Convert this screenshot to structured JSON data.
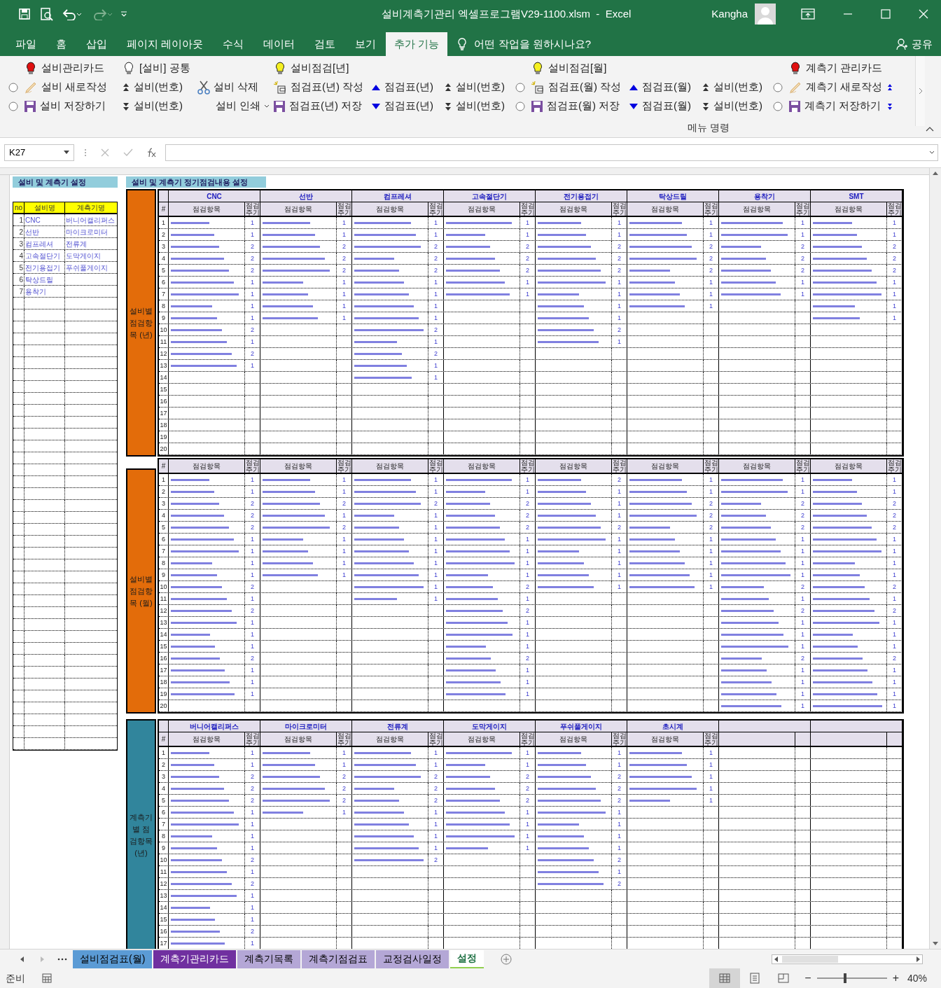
{
  "window": {
    "title": "설비계측기관리 엑셀프로그램V29-1100.xlsm  -  Excel",
    "user": "Kangha"
  },
  "tabs": [
    {
      "label": "파일",
      "selected": false
    },
    {
      "label": "홈",
      "selected": false
    },
    {
      "label": "삽입",
      "selected": false
    },
    {
      "label": "페이지 레이아웃",
      "selected": false
    },
    {
      "label": "수식",
      "selected": false
    },
    {
      "label": "데이터",
      "selected": false
    },
    {
      "label": "검토",
      "selected": false
    },
    {
      "label": "보기",
      "selected": false
    },
    {
      "label": "추가 기능",
      "selected": true
    }
  ],
  "tell_me": "어떤 작업을 원하시나요?",
  "share": "공유",
  "ribbon": {
    "group_label": "메뉴 명령",
    "columns": [
      {
        "middle": {
          "kind": "radio",
          "checked": false
        },
        "bottom": {
          "kind": "radio",
          "checked": false
        }
      },
      {
        "top": {
          "kind": "bulb",
          "color": "#e01010",
          "label": "설비관리카드"
        },
        "middle": {
          "kind": "pencil",
          "label": "설비 새로작성"
        },
        "bottom": {
          "kind": "save",
          "label": "설비 저장하기"
        }
      },
      {
        "top": {
          "kind": "bulb",
          "color": "#ffffff",
          "label": "[설비] 공통"
        },
        "middle": {
          "kind": "step_up",
          "label": "설비(번호)"
        },
        "bottom": {
          "kind": "step_down",
          "label": "설비(번호)"
        }
      },
      {
        "middle": {
          "kind": "scissors",
          "label": "설비 삭제"
        },
        "bottom": {
          "kind": "dropdown",
          "label": "설비 인쇄"
        }
      },
      {
        "top": {
          "kind": "bulb",
          "color": "#f5f020",
          "label": "설비점검[년]"
        },
        "middle": {
          "kind": "new_sheet",
          "label": "점검표(년) 작성"
        },
        "bottom": {
          "kind": "save",
          "label": "점검표(년) 저장"
        }
      },
      {
        "middle": {
          "kind": "triangle_up",
          "label": "점검표(년)"
        },
        "bottom": {
          "kind": "triangle_down",
          "label": "점검표(년)"
        }
      },
      {
        "middle": {
          "kind": "step_up",
          "label": "설비(번호)"
        },
        "bottom": {
          "kind": "step_down",
          "label": "설비(번호)"
        }
      },
      {
        "middle": {
          "kind": "radio",
          "checked": false
        },
        "bottom": {
          "kind": "radio",
          "checked": false
        }
      },
      {
        "top": {
          "kind": "bulb",
          "color": "#f5f020",
          "label": "설비점검[월]"
        },
        "middle": {
          "kind": "new_sheet",
          "label": "점검표(월) 작성"
        },
        "bottom": {
          "kind": "save",
          "label": "점검표(월) 저장"
        }
      },
      {
        "middle": {
          "kind": "triangle_up",
          "label": "점검표(월)"
        },
        "bottom": {
          "kind": "triangle_down",
          "label": "점검표(월)"
        }
      },
      {
        "middle": {
          "kind": "step_up",
          "label": "설비(번호)"
        },
        "bottom": {
          "kind": "step_down",
          "label": "설비(번호)"
        }
      },
      {
        "middle": {
          "kind": "radio",
          "checked": false
        },
        "bottom": {
          "kind": "radio",
          "checked": false
        }
      },
      {
        "top": {
          "kind": "bulb",
          "color": "#e01010",
          "label": "계측기 관리카드"
        },
        "middle": {
          "kind": "pencil",
          "label": "계측기 새로작성"
        },
        "bottom": {
          "kind": "save",
          "label": "계측기 저장하기"
        }
      },
      {
        "middle": {
          "kind": "step_up_blue"
        },
        "bottom": {
          "kind": "step_down_blue"
        }
      }
    ]
  },
  "name_box": "K27",
  "settings_title": "설비 및 계측기 설정",
  "equipment_table": {
    "headings": [
      "no",
      "설비명",
      "계측기명"
    ],
    "rows": [
      [
        "1",
        "CNC",
        "버니어캘리퍼스"
      ],
      [
        "2",
        "선반",
        "마이크로미터"
      ],
      [
        "3",
        "컴프레셔",
        "전류계"
      ],
      [
        "4",
        "고속절단기",
        "도막게이지"
      ],
      [
        "5",
        "전기용접기",
        "푸쉬풀게이지"
      ],
      [
        "6",
        "탁상드릴",
        ""
      ],
      [
        "7",
        "용착기",
        ""
      ]
    ]
  },
  "inspection_title": "설비 및 계측기 정기점검내용 설정",
  "blocks": [
    {
      "label": "설비별 점검항목 (년)",
      "color": "#e36c0a",
      "hash": "#",
      "row_numbers": [
        "1",
        "2",
        "3",
        "4",
        "5",
        "6",
        "7",
        "8",
        "9",
        "10",
        "11",
        "12",
        "13",
        "14",
        "15",
        "16",
        "17",
        "18",
        "19",
        "20"
      ],
      "columns": [
        {
          "name": "CNC",
          "item_heading": "점검항목",
          "period_heading": "점검주기",
          "periods": [
            "1",
            "1",
            "2",
            "2",
            "2",
            "1",
            "1",
            "1",
            "1",
            "2",
            "1",
            "2",
            "1"
          ]
        },
        {
          "name": "선반",
          "item_heading": "점검항목",
          "period_heading": "점검주기",
          "periods": [
            "1",
            "1",
            "2",
            "2",
            "2",
            "1",
            "1",
            "1",
            "1"
          ]
        },
        {
          "name": "컴프레셔",
          "item_heading": "점검항목",
          "period_heading": "점검주기",
          "periods": [
            "1",
            "1",
            "2",
            "2",
            "2",
            "1",
            "1",
            "1",
            "1",
            "2",
            "1",
            "2",
            "1",
            "1"
          ]
        },
        {
          "name": "고속절단기",
          "item_heading": "점검항목",
          "period_heading": "점검주기",
          "periods": [
            "1",
            "1",
            "2",
            "2",
            "2",
            "1",
            "1"
          ]
        },
        {
          "name": "전기용접기",
          "item_heading": "점검항목",
          "period_heading": "점검주기",
          "periods": [
            "1",
            "1",
            "2",
            "2",
            "2",
            "1",
            "1",
            "1",
            "1",
            "2",
            "1"
          ]
        },
        {
          "name": "탁상드릴",
          "item_heading": "점검항목",
          "period_heading": "점검주기",
          "periods": [
            "1",
            "1",
            "2",
            "2",
            "2",
            "1",
            "1",
            "1"
          ]
        },
        {
          "name": "용착기",
          "item_heading": "점검항목",
          "period_heading": "점검주기",
          "periods": [
            "1",
            "1",
            "2",
            "2",
            "2",
            "1",
            "1"
          ]
        },
        {
          "name": "SMT",
          "item_heading": "점검항목",
          "period_heading": "점검주기",
          "periods": [
            "1",
            "1",
            "2",
            "2",
            "2",
            "1",
            "1",
            "1",
            "1"
          ]
        }
      ]
    },
    {
      "label": "설비별 점검항목 (월)",
      "color": "#e36c0a",
      "hash": "#",
      "row_numbers": [
        "1",
        "2",
        "3",
        "4",
        "5",
        "6",
        "7",
        "8",
        "9",
        "10",
        "11",
        "12",
        "13",
        "14",
        "15",
        "16",
        "17",
        "18",
        "19",
        "20"
      ],
      "columns": [
        {
          "item_heading": "점검항목",
          "period_heading": "점검주기",
          "periods": [
            "1",
            "1",
            "2",
            "2",
            "2",
            "1",
            "1",
            "1",
            "1",
            "2",
            "1",
            "2",
            "1",
            "1",
            "1",
            "2",
            "1",
            "1",
            "1"
          ]
        },
        {
          "item_heading": "점검항목",
          "period_heading": "점검주기",
          "periods": [
            "1",
            "1",
            "2",
            "1",
            "2",
            "1",
            "1",
            "1",
            "1"
          ]
        },
        {
          "item_heading": "점검항목",
          "period_heading": "점검주기",
          "periods": [
            "1",
            "1",
            "2",
            "1",
            "1",
            "1",
            "1",
            "1",
            "1",
            "1",
            "1"
          ]
        },
        {
          "item_heading": "점검항목",
          "period_heading": "점검주기",
          "periods": [
            "1",
            "1",
            "2",
            "2",
            "2",
            "1",
            "1",
            "1",
            "1",
            "2",
            "1",
            "2",
            "1",
            "1",
            "1",
            "2",
            "1",
            "1",
            "1"
          ]
        },
        {
          "item_heading": "점검항목",
          "period_heading": "점검주기",
          "periods": [
            "2",
            "1",
            "1",
            "1",
            "2",
            "1",
            "1",
            "1",
            "1",
            "1"
          ]
        },
        {
          "item_heading": "점검항목",
          "period_heading": "점검주기",
          "periods": [
            "1",
            "1",
            "2",
            "2",
            "2",
            "1",
            "1",
            "1",
            "1",
            "1"
          ]
        },
        {
          "item_heading": "점검항목",
          "period_heading": "점검주기",
          "periods": [
            "1",
            "1",
            "2",
            "2",
            "2",
            "1",
            "1",
            "1",
            "1",
            "2",
            "1",
            "2",
            "1",
            "1",
            "1",
            "2",
            "1",
            "1",
            "1",
            "1"
          ]
        },
        {
          "item_heading": "점검항목",
          "period_heading": "점검주기",
          "periods": [
            "1",
            "1",
            "2",
            "2",
            "2",
            "1",
            "1",
            "1",
            "1",
            "2",
            "1",
            "2",
            "1",
            "1",
            "1",
            "2",
            "1",
            "1",
            "1",
            "1"
          ]
        }
      ]
    },
    {
      "label": "계측기별 점검항목 (년)",
      "color": "#31859c",
      "hash": "#",
      "row_numbers": [
        "1",
        "2",
        "3",
        "4",
        "5",
        "6",
        "7",
        "8",
        "9",
        "10",
        "11",
        "12",
        "13",
        "14",
        "15",
        "16",
        "17"
      ],
      "columns": [
        {
          "name": "버니어캘리퍼스",
          "item_heading": "점검항목",
          "period_heading": "점검주기",
          "periods": [
            "1",
            "1",
            "2",
            "2",
            "2",
            "1",
            "1",
            "1",
            "1",
            "2",
            "1",
            "2",
            "1",
            "1",
            "1",
            "2",
            "1"
          ]
        },
        {
          "name": "마이크로미터",
          "item_heading": "점검항목",
          "period_heading": "점검주기",
          "periods": [
            "1",
            "1",
            "2",
            "2",
            "2",
            "1"
          ]
        },
        {
          "name": "전류계",
          "item_heading": "점검항목",
          "period_heading": "점검주기",
          "periods": [
            "1",
            "1",
            "2",
            "2",
            "2",
            "1",
            "1",
            "1",
            "1",
            "2"
          ]
        },
        {
          "name": "도막게이지",
          "item_heading": "점검항목",
          "period_heading": "점검주기",
          "periods": [
            "1",
            "1",
            "2",
            "2",
            "2",
            "1",
            "1",
            "1",
            "1"
          ]
        },
        {
          "name": "푸쉬풀게이지",
          "item_heading": "점검항목",
          "period_heading": "점검주기",
          "periods": [
            "1",
            "1",
            "2",
            "2",
            "2",
            "1",
            "1",
            "1",
            "1",
            "2",
            "1",
            "2"
          ]
        },
        {
          "name": "초시계",
          "item_heading": "점검항목",
          "period_heading": "점검주기",
          "periods": [
            "1",
            "1",
            "1",
            "1",
            "1"
          ]
        }
      ]
    }
  ],
  "sheet_tabs": [
    {
      "label": "설비점검표(월)",
      "color": "#5b9bd5",
      "selected": false
    },
    {
      "label": "계측기관리카드",
      "color": "#7030a0",
      "selected": false
    },
    {
      "label": "계측기목록",
      "color": "#b4a7d6",
      "selected": false
    },
    {
      "label": "계측기점검표",
      "color": "#b4a7d6",
      "selected": false
    },
    {
      "label": "교정검사일정",
      "color": "#b4a7d6",
      "selected": false
    },
    {
      "label": "설정",
      "color": "#92d050",
      "selected": true
    }
  ],
  "status": "준비",
  "zoom": {
    "out": "−",
    "in": "+",
    "label": "40%",
    "level": 0.4
  }
}
